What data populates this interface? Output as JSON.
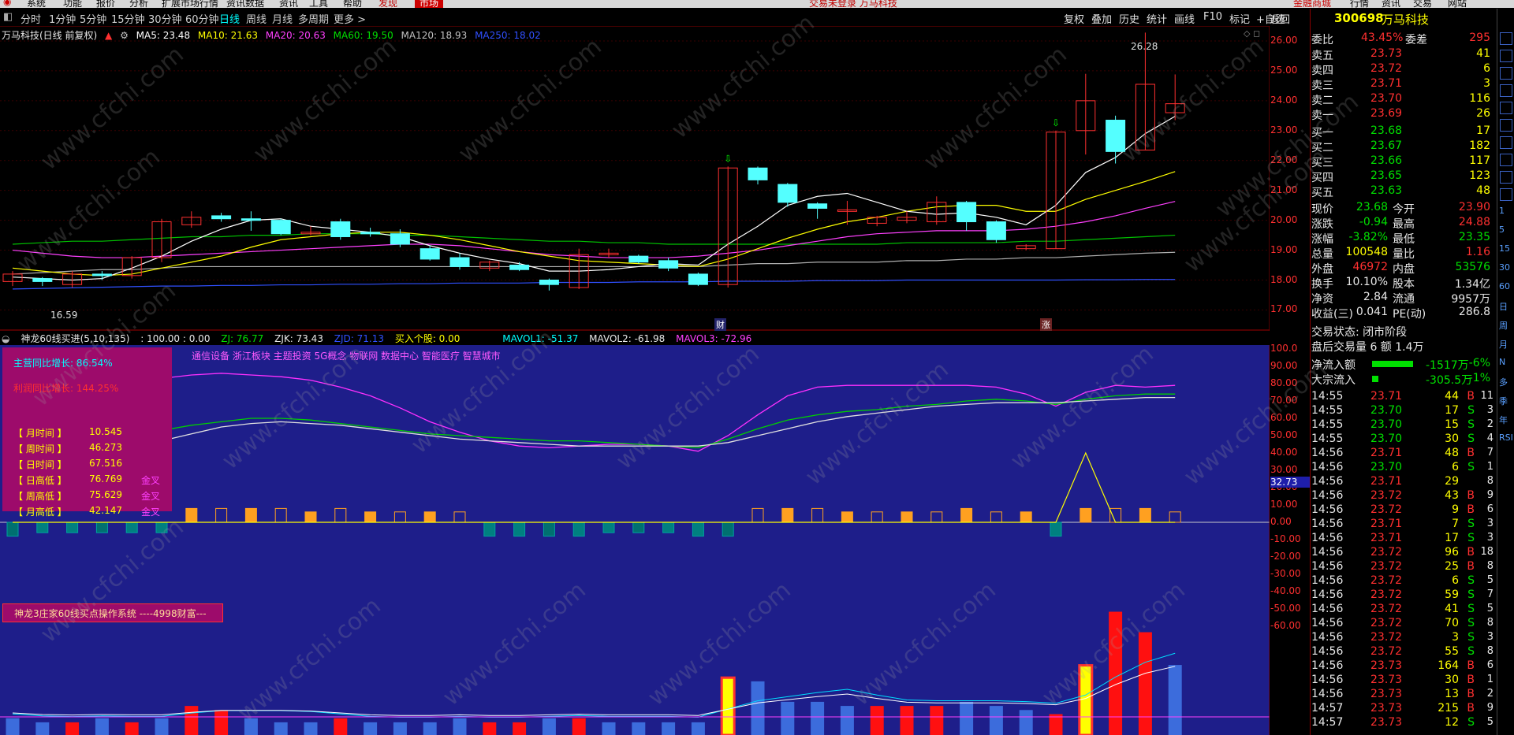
{
  "menu": {
    "items": [
      "系统",
      "功能",
      "报价",
      "分析",
      "扩展市场行情",
      "资讯数据",
      "资讯",
      "工具",
      "帮助"
    ],
    "market_label": "市场",
    "fx_label": "发现",
    "center_status": "交易未登录  万马科技",
    "right_items": [
      "金融商城",
      "行情",
      "资讯",
      "交易",
      "网站"
    ]
  },
  "periods": [
    "分时",
    "1分钟",
    "5分钟",
    "15分钟",
    "30分钟",
    "60分钟",
    "日线",
    "周线",
    "月线",
    "多周期",
    "更多 >"
  ],
  "active_period": "日线",
  "toolbar_right": [
    "复权",
    "叠加",
    "历史",
    "统计",
    "画线",
    "F10",
    "标记",
    "+自选",
    "返回"
  ],
  "kline": {
    "title": "万马科技(日线 前复权)",
    "ma": [
      {
        "label": "MA5: 23.48",
        "color": "#ffffff"
      },
      {
        "label": "MA10: 21.63",
        "color": "#ffff00"
      },
      {
        "label": "MA20: 20.63",
        "color": "#ff40ff"
      },
      {
        "label": "MA60: 19.50",
        "color": "#00e000"
      },
      {
        "label": "MA120: 18.93",
        "color": "#c0c0c0"
      },
      {
        "label": "MA250: 18.02",
        "color": "#3050ff"
      }
    ],
    "high_label": "26.28",
    "low_label": "16.59",
    "marker_cai": "财",
    "marker_zhang": "涨",
    "axis": [
      "26.00",
      "25.00",
      "24.00",
      "23.00",
      "22.00",
      "21.00",
      "20.00",
      "19.00",
      "18.00",
      "17.00"
    ],
    "candles": [
      [
        17.95,
        18.2,
        17.8,
        18.3
      ],
      [
        18.05,
        17.95,
        17.8,
        18.1
      ],
      [
        17.85,
        18.2,
        17.75,
        18.3
      ],
      [
        18.2,
        18.15,
        18.0,
        18.3
      ],
      [
        18.15,
        18.75,
        18.05,
        18.8
      ],
      [
        18.75,
        19.95,
        18.6,
        20.05
      ],
      [
        19.85,
        20.1,
        19.75,
        20.3
      ],
      [
        20.15,
        20.05,
        19.95,
        20.25
      ],
      [
        20.05,
        20.0,
        19.65,
        20.3
      ],
      [
        20.0,
        19.55,
        19.5,
        20.05
      ],
      [
        19.55,
        19.6,
        19.5,
        19.8
      ],
      [
        19.95,
        19.45,
        19.35,
        20.05
      ],
      [
        19.6,
        19.55,
        19.45,
        19.75
      ],
      [
        19.55,
        19.2,
        19.1,
        19.7
      ],
      [
        19.05,
        18.7,
        18.65,
        19.15
      ],
      [
        18.75,
        18.45,
        18.35,
        18.9
      ],
      [
        18.4,
        18.6,
        18.3,
        18.65
      ],
      [
        18.5,
        18.35,
        18.3,
        18.6
      ],
      [
        18.0,
        17.85,
        17.65,
        18.05
      ],
      [
        17.75,
        18.85,
        17.7,
        19.05
      ],
      [
        18.9,
        18.9,
        18.75,
        19.05
      ],
      [
        18.8,
        18.6,
        18.55,
        18.85
      ],
      [
        18.65,
        18.4,
        18.3,
        18.75
      ],
      [
        18.2,
        17.85,
        17.8,
        18.25
      ],
      [
        17.85,
        21.75,
        17.75,
        21.8
      ],
      [
        21.75,
        21.35,
        21.2,
        21.8
      ],
      [
        21.2,
        20.6,
        20.45,
        21.25
      ],
      [
        20.55,
        20.4,
        20.05,
        20.6
      ],
      [
        20.35,
        20.35,
        19.85,
        20.65
      ],
      [
        19.9,
        20.1,
        19.8,
        20.15
      ],
      [
        20.0,
        20.1,
        19.9,
        20.3
      ],
      [
        19.95,
        20.6,
        19.85,
        20.8
      ],
      [
        20.6,
        19.95,
        19.65,
        20.65
      ],
      [
        19.95,
        19.35,
        19.25,
        20.0
      ],
      [
        19.05,
        19.15,
        19.0,
        19.2
      ],
      [
        19.05,
        22.95,
        19.05,
        23.0
      ],
      [
        23.0,
        24.0,
        22.2,
        24.9
      ],
      [
        23.35,
        22.3,
        21.9,
        23.5
      ],
      [
        22.35,
        24.55,
        22.35,
        26.28
      ],
      [
        23.6,
        23.9,
        23.35,
        24.88
      ]
    ],
    "ma5": [
      18.1,
      18.05,
      18.0,
      18.05,
      18.4,
      18.8,
      19.3,
      19.7,
      20.0,
      20.05,
      19.8,
      19.7,
      19.6,
      19.45,
      19.15,
      18.9,
      18.7,
      18.55,
      18.3,
      18.3,
      18.35,
      18.45,
      18.55,
      18.5,
      19.2,
      19.8,
      20.5,
      20.8,
      20.9,
      20.6,
      20.3,
      20.2,
      20.25,
      20.1,
      19.85,
      20.5,
      21.6,
      22.1,
      22.9,
      23.48
    ],
    "ma10": [
      18.4,
      18.3,
      18.2,
      18.15,
      18.2,
      18.4,
      18.6,
      18.8,
      19.1,
      19.35,
      19.45,
      19.55,
      19.6,
      19.6,
      19.5,
      19.35,
      19.15,
      18.95,
      18.8,
      18.65,
      18.6,
      18.55,
      18.5,
      18.45,
      18.7,
      19.05,
      19.4,
      19.7,
      19.95,
      20.1,
      20.3,
      20.45,
      20.5,
      20.5,
      20.3,
      20.3,
      20.7,
      21.0,
      21.3,
      21.63
    ],
    "ma20": [
      19.0,
      18.9,
      18.8,
      18.75,
      18.75,
      18.8,
      18.85,
      18.9,
      18.95,
      19.0,
      19.05,
      19.1,
      19.15,
      19.2,
      19.2,
      19.15,
      19.05,
      18.95,
      18.85,
      18.8,
      18.75,
      18.75,
      18.75,
      18.8,
      18.9,
      19.0,
      19.15,
      19.3,
      19.45,
      19.55,
      19.6,
      19.65,
      19.65,
      19.65,
      19.7,
      19.8,
      19.95,
      20.15,
      20.4,
      20.63
    ],
    "ma60": [
      19.2,
      19.25,
      19.3,
      19.3,
      19.35,
      19.4,
      19.45,
      19.45,
      19.5,
      19.5,
      19.55,
      19.55,
      19.55,
      19.5,
      19.5,
      19.45,
      19.4,
      19.35,
      19.3,
      19.3,
      19.25,
      19.25,
      19.2,
      19.2,
      19.2,
      19.2,
      19.2,
      19.2,
      19.2,
      19.2,
      19.25,
      19.25,
      19.25,
      19.25,
      19.3,
      19.3,
      19.35,
      19.4,
      19.45,
      19.5
    ],
    "ma120": [
      18.2,
      18.25,
      18.3,
      18.35,
      18.35,
      18.4,
      18.45,
      18.45,
      18.45,
      18.45,
      18.45,
      18.45,
      18.45,
      18.45,
      18.45,
      18.45,
      18.45,
      18.45,
      18.45,
      18.45,
      18.45,
      18.45,
      18.45,
      18.45,
      18.5,
      18.55,
      18.55,
      18.6,
      18.6,
      18.6,
      18.65,
      18.65,
      18.7,
      18.7,
      18.75,
      18.75,
      18.8,
      18.85,
      18.9,
      18.93
    ],
    "ma250": [
      17.7,
      17.72,
      17.74,
      17.76,
      17.78,
      17.8,
      17.8,
      17.82,
      17.82,
      17.84,
      17.84,
      17.86,
      17.86,
      17.88,
      17.88,
      17.9,
      17.9,
      17.9,
      17.92,
      17.92,
      17.92,
      17.94,
      17.94,
      17.94,
      17.96,
      17.96,
      17.96,
      17.98,
      17.98,
      17.98,
      18.0,
      18.0,
      18.0,
      18.0,
      18.0,
      18.0,
      18.01,
      18.01,
      18.02,
      18.02
    ]
  },
  "ind2": {
    "title": "神龙60线买进(5,10,135)",
    "params": ": 100.00 : 0.00",
    "zj": "ZJ: 76.77",
    "zjk": "ZJK: 73.43",
    "zjd": "ZJD: 71.13",
    "buy": "买入个股: 0.00",
    "mavol1": "MAVOL1: -51.37",
    "mavol2": "MAVOL2: -61.98",
    "mavol3": "MAVOL3: -72.96",
    "axis": [
      "100.0",
      "90.00",
      "80.00",
      "70.00",
      "60.00",
      "50.00",
      "40.00",
      "30.00",
      "20.00",
      "10.00",
      "0.00",
      "-10.00",
      "-20.00",
      "-30.00",
      "-40.00",
      "-50.00",
      "-60.00"
    ],
    "current_tag": "32.73",
    "concepts": "通信设备 浙江板块 主题投资 5G概念 物联网 数据中心 智能医疗 智慧城市",
    "system_label": "神龙3庄家60线买点操作系统 ----4998财富---",
    "info": {
      "main_growth_label": "主营同比增长:",
      "main_growth_value": "86.54%",
      "profit_growth_label": "利润同比增长:",
      "profit_growth_value": "144.25%",
      "rows": [
        {
          "label": "【 月时间 】",
          "value": "10.545",
          "tag": ""
        },
        {
          "label": "【 周时间 】",
          "value": "46.273",
          "tag": ""
        },
        {
          "label": "【 日时间 】",
          "value": "67.516",
          "tag": ""
        },
        {
          "label": "【 日高低 】",
          "value": "76.769",
          "tag": "金叉"
        },
        {
          "label": "【 周高低 】",
          "value": "75.629",
          "tag": "金叉"
        },
        {
          "label": "【 月高低 】",
          "value": "42.147",
          "tag": "金叉"
        }
      ]
    },
    "magenta": [
      72,
      70,
      68,
      72,
      80,
      83,
      85,
      86,
      85,
      84,
      82,
      78,
      73,
      66,
      58,
      52,
      47,
      44,
      43,
      44,
      45,
      45,
      44,
      41,
      50,
      62,
      73,
      78,
      79,
      79,
      79,
      79,
      79,
      78,
      74,
      67,
      75,
      79,
      78,
      79
    ],
    "green": [
      40,
      39,
      38,
      42,
      48,
      53,
      56,
      58,
      60,
      60,
      59,
      57,
      55,
      53,
      51,
      50,
      49,
      48,
      47,
      47,
      46,
      45,
      44,
      43,
      48,
      54,
      59,
      62,
      64,
      65,
      67,
      68,
      70,
      71,
      70,
      68,
      71,
      73,
      74,
      74
    ],
    "white": [
      38,
      36,
      35,
      37,
      42,
      47,
      51,
      55,
      57,
      58,
      57,
      56,
      54,
      52,
      50,
      48,
      47,
      46,
      45,
      44,
      44,
      44,
      44,
      44,
      46,
      50,
      54,
      58,
      61,
      63,
      65,
      67,
      68,
      69,
      69,
      69,
      70,
      71,
      72,
      72
    ],
    "bars": [
      -8,
      -6,
      -6,
      -6,
      -6,
      -6,
      8,
      8,
      8,
      8,
      6,
      8,
      6,
      6,
      6,
      6,
      -8,
      -8,
      -8,
      -8,
      -6,
      -6,
      -6,
      -8,
      -8,
      8,
      8,
      8,
      6,
      6,
      6,
      6,
      8,
      6,
      6,
      -8,
      8,
      8,
      8,
      6
    ],
    "yel_spike": [
      0,
      0,
      0,
      0,
      0,
      0,
      0,
      0,
      0,
      0,
      0,
      0,
      0,
      0,
      0,
      0,
      0,
      0,
      0,
      0,
      0,
      0,
      0,
      0,
      0,
      0,
      0,
      0,
      0,
      0,
      0,
      0,
      0,
      0,
      0,
      0,
      40,
      0,
      0,
      0
    ],
    "vol": [
      4,
      3,
      3,
      4,
      3,
      4,
      7,
      6,
      4,
      3,
      3,
      4,
      3,
      3,
      3,
      4,
      3,
      3,
      4,
      4,
      3,
      3,
      3,
      3,
      14,
      13,
      8,
      8,
      7,
      7,
      7,
      7,
      8,
      7,
      6,
      5,
      17,
      30,
      25,
      17
    ],
    "vol_color": [
      1,
      1,
      0,
      1,
      0,
      1,
      0,
      0,
      1,
      1,
      1,
      0,
      1,
      1,
      1,
      1,
      0,
      0,
      1,
      0,
      1,
      1,
      1,
      1,
      2,
      1,
      1,
      1,
      1,
      0,
      0,
      0,
      1,
      1,
      1,
      0,
      2,
      0,
      0,
      1
    ]
  },
  "quote": {
    "code": "300698",
    "name": "万马科技",
    "weibi_label": "委比",
    "weibi": "43.45%",
    "weicha_label": "委差",
    "weicha": "295",
    "asks": [
      [
        "卖五",
        "23.73",
        "41"
      ],
      [
        "卖四",
        "23.72",
        "6"
      ],
      [
        "卖三",
        "23.71",
        "3"
      ],
      [
        "卖二",
        "23.70",
        "116"
      ],
      [
        "卖一",
        "23.69",
        "26"
      ]
    ],
    "bids": [
      [
        "买一",
        "23.68",
        "17"
      ],
      [
        "买二",
        "23.67",
        "182"
      ],
      [
        "买三",
        "23.66",
        "117"
      ],
      [
        "买四",
        "23.65",
        "123"
      ],
      [
        "买五",
        "23.63",
        "48"
      ]
    ],
    "stats": [
      [
        "现价",
        "23.68",
        "今开",
        "23.90"
      ],
      [
        "涨跌",
        "-0.94",
        "最高",
        "24.88"
      ],
      [
        "涨幅",
        "-3.82%",
        "最低",
        "23.35"
      ],
      [
        "总量",
        "100548",
        "量比",
        "1.16"
      ],
      [
        "外盘",
        "46972",
        "内盘",
        "53576"
      ],
      [
        "换手",
        "10.10%",
        "股本",
        "1.34亿"
      ],
      [
        "净资",
        "2.84",
        "流通",
        "9957万"
      ],
      [
        "收益(三)",
        "0.041",
        "PE(动)",
        "286.8"
      ]
    ],
    "trade_status": "交易状态: 闭市阶段",
    "after_hours": "盘后交易量 6 额 1.4万",
    "net_inflow_label": "净流入额",
    "net_inflow": "-1517万",
    "net_inflow_pct": "-6%",
    "big_inflow_label": "大宗流入",
    "big_inflow": "-305.5万",
    "big_inflow_pct": "-1%",
    "ticks": [
      [
        "14:55",
        "23.71",
        "44",
        "B",
        "11"
      ],
      [
        "14:55",
        "23.70",
        "17",
        "S",
        "3"
      ],
      [
        "14:55",
        "23.70",
        "15",
        "S",
        "2"
      ],
      [
        "14:55",
        "23.70",
        "30",
        "S",
        "4"
      ],
      [
        "14:56",
        "23.71",
        "48",
        "B",
        "7"
      ],
      [
        "14:56",
        "23.70",
        "6",
        "S",
        "1"
      ],
      [
        "14:56",
        "23.71",
        "29",
        "",
        "8"
      ],
      [
        "14:56",
        "23.72",
        "43",
        "B",
        "9"
      ],
      [
        "14:56",
        "23.72",
        "9",
        "B",
        "6"
      ],
      [
        "14:56",
        "23.71",
        "7",
        "S",
        "3"
      ],
      [
        "14:56",
        "23.71",
        "17",
        "S",
        "3"
      ],
      [
        "14:56",
        "23.72",
        "96",
        "B",
        "18"
      ],
      [
        "14:56",
        "23.72",
        "25",
        "B",
        "8"
      ],
      [
        "14:56",
        "23.72",
        "6",
        "S",
        "5"
      ],
      [
        "14:56",
        "23.72",
        "59",
        "S",
        "7"
      ],
      [
        "14:56",
        "23.72",
        "41",
        "S",
        "5"
      ],
      [
        "14:56",
        "23.72",
        "70",
        "S",
        "8"
      ],
      [
        "14:56",
        "23.72",
        "3",
        "S",
        "3"
      ],
      [
        "14:56",
        "23.72",
        "55",
        "S",
        "8"
      ],
      [
        "14:56",
        "23.73",
        "164",
        "B",
        "6"
      ],
      [
        "14:56",
        "23.73",
        "30",
        "B",
        "1"
      ],
      [
        "14:56",
        "23.73",
        "13",
        "B",
        "2"
      ],
      [
        "14:57",
        "23.73",
        "215",
        "B",
        "9"
      ],
      [
        "14:57",
        "23.73",
        "12",
        "S",
        "5"
      ]
    ]
  },
  "sidebar_icons": [
    "1",
    "5",
    "15",
    "30",
    "60",
    "日",
    "周",
    "月",
    "N",
    "多",
    "季",
    "年",
    "RSI"
  ],
  "watermark": "www.cfchi.com",
  "colors": {
    "up": "#ff3030",
    "down": "#54ffff",
    "bg_ind": "#1e1e8a",
    "info_bg": "#9d0b6b"
  }
}
